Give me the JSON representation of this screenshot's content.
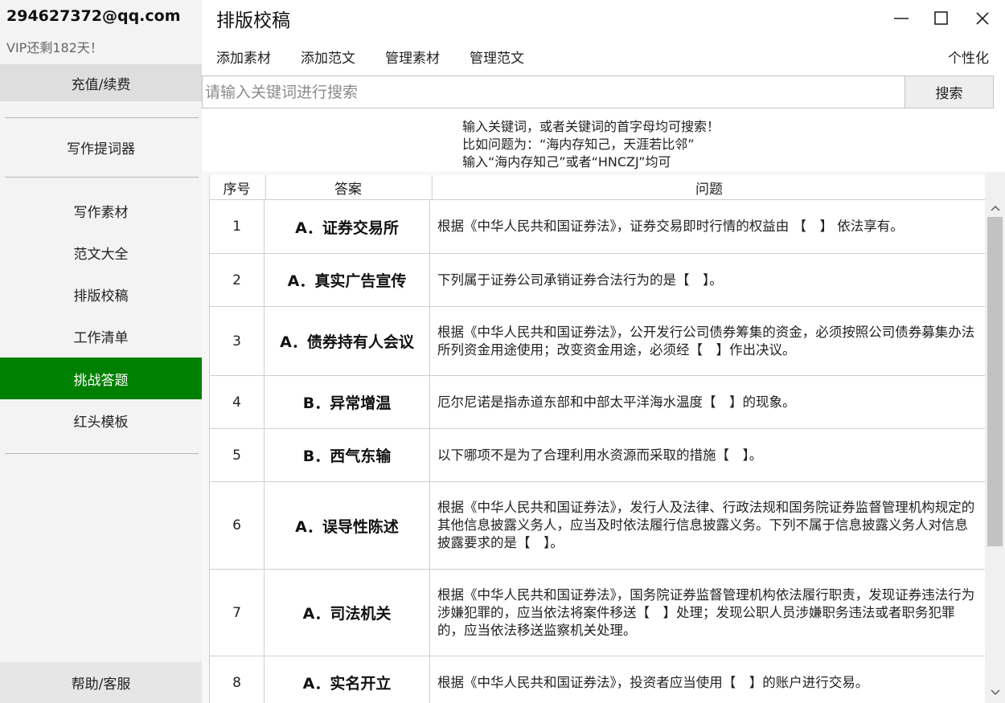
{
  "sidebar": {
    "email": "294627372@qq.com",
    "vip": "VIP还剩182天！",
    "recharge_label": "充值/续费",
    "prompter_label": "写作提词器",
    "items": [
      {
        "label": "写作素材"
      },
      {
        "label": "范文大全"
      },
      {
        "label": "排版校稿"
      },
      {
        "label": "工作清单"
      },
      {
        "label": "挑战答题"
      },
      {
        "label": "红头模板"
      }
    ],
    "active_item": "挑战答题",
    "help_label": "帮助/客服",
    "accent_color": "#008000"
  },
  "header": {
    "title": "排版校稿",
    "window_controls": {
      "minimize": "—",
      "maximize": "☐",
      "close": "X"
    }
  },
  "toolbar": {
    "items": [
      "添加素材",
      "添加范文",
      "管理素材",
      "管理范文"
    ],
    "personalize_label": "个性化"
  },
  "search": {
    "placeholder": "请输入关键词进行搜索",
    "value": "",
    "button_label": "搜索"
  },
  "hints": [
    "输入关键词，或者关键词的首字母均可搜索！",
    "比如问题为：“海内存知己，天涯若比邻”",
    "输入“海内存知己”或者“HNCZJ”均可"
  ],
  "table": {
    "headers": {
      "no": "序号",
      "answer": "答案",
      "question": "问题"
    },
    "rows": [
      {
        "no": "1",
        "answer": "A．证券交易所",
        "question": "根据《中华人民共和国证券法》，证券交易即时行情的权益由 【　】 依法享有。"
      },
      {
        "no": "2",
        "answer": "A．真实广告宣传",
        "question": "下列属于证券公司承销证券合法行为的是【　】。"
      },
      {
        "no": "3",
        "answer": "A．债券持有人会议",
        "question": "根据《中华人民共和国证券法》，公开发行公司债券筹集的资金，必须按照公司债券募集办法所列资金用途使用；改变资金用途，必须经【　】作出决议。"
      },
      {
        "no": "4",
        "answer": "B．异常增温",
        "question": "厄尔尼诺是指赤道东部和中部太平洋海水温度【　】的现象。"
      },
      {
        "no": "5",
        "answer": "B．西气东输",
        "question": "以下哪项不是为了合理利用水资源而采取的措施【　】。"
      },
      {
        "no": "6",
        "answer": "A．误导性陈述",
        "question": "根据《中华人民共和国证券法》，发行人及法律、行政法规和国务院证券监督管理机构规定的其他信息披露义务人，应当及时依法履行信息披露义务。下列不属于信息披露义务人对信息披露要求的是【　】。"
      },
      {
        "no": "7",
        "answer": "A．司法机关",
        "question": "根据《中华人民共和国证券法》，国务院证券监督管理机构依法履行职责，发现证券违法行为涉嫌犯罪的，应当依法将案件移送【　】处理；发现公职人员涉嫌职务违法或者职务犯罪的，应当依法移送监察机关处理。"
      },
      {
        "no": "8",
        "answer": "A．实名开立",
        "question": "根据《中华人民共和国证券法》，投资者应当使用【　】的账户进行交易。"
      }
    ]
  }
}
